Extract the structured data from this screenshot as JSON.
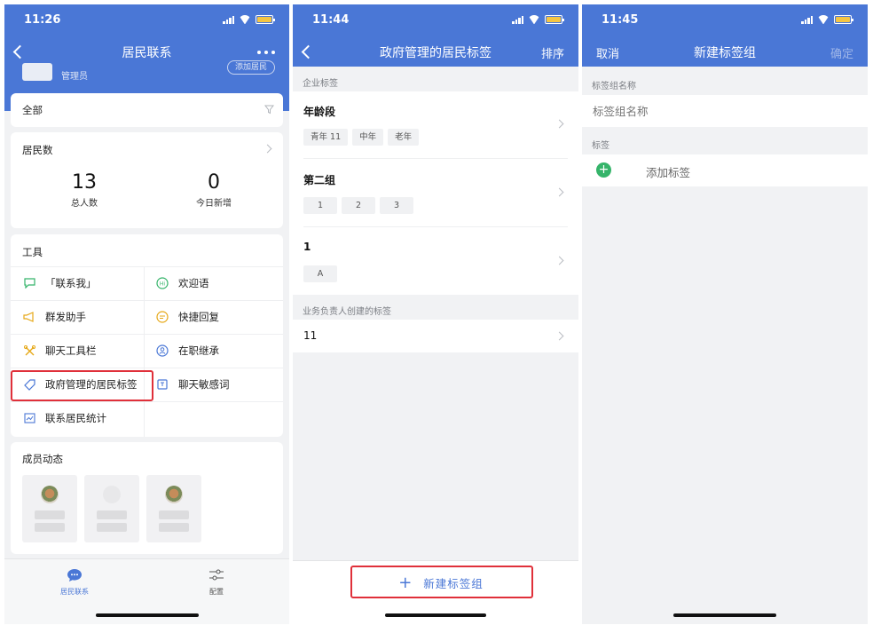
{
  "colors": {
    "brand": "#4a77d6",
    "highlight": "#e0303a",
    "add_green": "#35b46a"
  },
  "screen1": {
    "time": "11:26",
    "title": "居民联系",
    "admin_label": "管理员",
    "add_resident": "添加居民",
    "filter": {
      "label": "全部"
    },
    "residents": {
      "title": "居民数",
      "total_value": "13",
      "total_label": "总人数",
      "new_value": "0",
      "new_label": "今日新增"
    },
    "tools": {
      "title": "工具",
      "items": [
        {
          "label": "「联系我」",
          "icon": "chat-icon"
        },
        {
          "label": "欢迎语",
          "icon": "hi-icon"
        },
        {
          "label": "群发助手",
          "icon": "megaphone-icon"
        },
        {
          "label": "快捷回复",
          "icon": "quick-reply-icon"
        },
        {
          "label": "聊天工具栏",
          "icon": "toolbar-icon"
        },
        {
          "label": "在职继承",
          "icon": "transfer-icon"
        },
        {
          "label": "政府管理的居民标签",
          "icon": "tag-icon"
        },
        {
          "label": "聊天敏感词",
          "icon": "sensitive-word-icon"
        },
        {
          "label": "联系居民统计",
          "icon": "stats-icon"
        }
      ]
    },
    "members": {
      "title": "成员动态"
    },
    "tabs": [
      {
        "label": "居民联系",
        "icon": "chat-bubble-icon",
        "active": true
      },
      {
        "label": "配置",
        "icon": "sliders-icon",
        "active": false
      }
    ]
  },
  "screen2": {
    "time": "11:44",
    "title": "政府管理的居民标签",
    "sort": "排序",
    "enterprise_section": "企业标签",
    "groups": [
      {
        "name": "年龄段",
        "tags": [
          "青年 11",
          "中年",
          "老年"
        ]
      },
      {
        "name": "第二组",
        "tags": [
          "1",
          "2",
          "3"
        ]
      },
      {
        "name": "1",
        "tags": [
          "A"
        ]
      }
    ],
    "owner_section": "业务负责人创建的标签",
    "owner_tags": [
      {
        "name": "11"
      }
    ],
    "new_group_button": "新建标签组"
  },
  "screen3": {
    "time": "11:45",
    "cancel": "取消",
    "title": "新建标签组",
    "confirm": "确定",
    "group_name_label": "标签组名称",
    "group_name_placeholder": "标签组名称",
    "tags_label": "标签",
    "add_tag": "添加标签"
  }
}
